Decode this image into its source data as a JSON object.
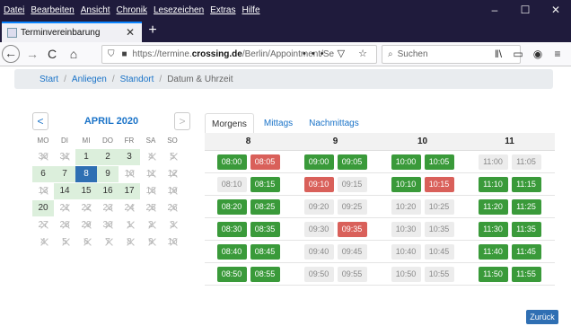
{
  "menu": [
    "Datei",
    "Bearbeiten",
    "Ansicht",
    "Chronik",
    "Lesezeichen",
    "Extras",
    "Hilfe"
  ],
  "window_controls": [
    "–",
    "☐",
    "✕"
  ],
  "tab": {
    "title": "Terminvereinbarung",
    "close": "✕",
    "new_tab": "+"
  },
  "nav": {
    "back": "←",
    "forward": "→",
    "reload": "C",
    "home": "⌂",
    "url_prefix": "https://termine.",
    "url_domain": "crossing.de",
    "url_path": "/Berlin/Appointment/Se",
    "url_icons": "••• ▽ ☆",
    "search_placeholder": "Suchen",
    "toolbar_icons": [
      "‖\\",
      "▭",
      "◉",
      "≡"
    ]
  },
  "breadcrumb": {
    "start": "Start",
    "anliegen": "Anliegen",
    "standort": "Standort",
    "current": "Datum & Uhrzeit",
    "sep": "/"
  },
  "calendar": {
    "month": "APRIL 2020",
    "prev": "<",
    "next": ">",
    "weekdays": [
      "MO",
      "DI",
      "MI",
      "DO",
      "FR",
      "SA",
      "SO"
    ],
    "cells": [
      {
        "d": "30",
        "s": "na"
      },
      {
        "d": "31",
        "s": "na"
      },
      {
        "d": "1",
        "s": "av"
      },
      {
        "d": "2",
        "s": "av"
      },
      {
        "d": "3",
        "s": "av"
      },
      {
        "d": "4",
        "s": "na"
      },
      {
        "d": "5",
        "s": "na"
      },
      {
        "d": "6",
        "s": "av"
      },
      {
        "d": "7",
        "s": "av"
      },
      {
        "d": "8",
        "s": "sel"
      },
      {
        "d": "9",
        "s": "av"
      },
      {
        "d": "10",
        "s": "na"
      },
      {
        "d": "11",
        "s": "na"
      },
      {
        "d": "12",
        "s": "na"
      },
      {
        "d": "13",
        "s": "na"
      },
      {
        "d": "14",
        "s": "av"
      },
      {
        "d": "15",
        "s": "av"
      },
      {
        "d": "16",
        "s": "av"
      },
      {
        "d": "17",
        "s": "av"
      },
      {
        "d": "18",
        "s": "na"
      },
      {
        "d": "19",
        "s": "na"
      },
      {
        "d": "20",
        "s": "av"
      },
      {
        "d": "21",
        "s": "na"
      },
      {
        "d": "22",
        "s": "na"
      },
      {
        "d": "23",
        "s": "na"
      },
      {
        "d": "24",
        "s": "na"
      },
      {
        "d": "25",
        "s": "na"
      },
      {
        "d": "26",
        "s": "na"
      },
      {
        "d": "27",
        "s": "na"
      },
      {
        "d": "28",
        "s": "na"
      },
      {
        "d": "29",
        "s": "na"
      },
      {
        "d": "30",
        "s": "na"
      },
      {
        "d": "1",
        "s": "na"
      },
      {
        "d": "2",
        "s": "na"
      },
      {
        "d": "3",
        "s": "na"
      },
      {
        "d": "4",
        "s": "na"
      },
      {
        "d": "5",
        "s": "na"
      },
      {
        "d": "6",
        "s": "na"
      },
      {
        "d": "7",
        "s": "na"
      },
      {
        "d": "8",
        "s": "na"
      },
      {
        "d": "9",
        "s": "na"
      },
      {
        "d": "10",
        "s": "na"
      }
    ]
  },
  "time_tabs": [
    "Morgens",
    "Mittags",
    "Nachmittags"
  ],
  "slot_hours": [
    "8",
    "9",
    "10",
    "11"
  ],
  "slot_rows": [
    [
      {
        "t": "08:00",
        "s": "free"
      },
      {
        "t": "08:05",
        "s": "busy"
      },
      {
        "t": "09:00",
        "s": "free"
      },
      {
        "t": "09:05",
        "s": "free"
      },
      {
        "t": "10:00",
        "s": "free"
      },
      {
        "t": "10:05",
        "s": "free"
      },
      {
        "t": "11:00",
        "s": "off"
      },
      {
        "t": "11:05",
        "s": "off"
      }
    ],
    [
      {
        "t": "08:10",
        "s": "off"
      },
      {
        "t": "08:15",
        "s": "free"
      },
      {
        "t": "09:10",
        "s": "busy"
      },
      {
        "t": "09:15",
        "s": "off"
      },
      {
        "t": "10:10",
        "s": "free"
      },
      {
        "t": "10:15",
        "s": "busy"
      },
      {
        "t": "11:10",
        "s": "free"
      },
      {
        "t": "11:15",
        "s": "free"
      }
    ],
    [
      {
        "t": "08:20",
        "s": "free"
      },
      {
        "t": "08:25",
        "s": "free"
      },
      {
        "t": "09:20",
        "s": "off"
      },
      {
        "t": "09:25",
        "s": "off"
      },
      {
        "t": "10:20",
        "s": "off"
      },
      {
        "t": "10:25",
        "s": "off"
      },
      {
        "t": "11:20",
        "s": "free"
      },
      {
        "t": "11:25",
        "s": "free"
      }
    ],
    [
      {
        "t": "08:30",
        "s": "free"
      },
      {
        "t": "08:35",
        "s": "free"
      },
      {
        "t": "09:30",
        "s": "off"
      },
      {
        "t": "09:35",
        "s": "busy"
      },
      {
        "t": "10:30",
        "s": "off"
      },
      {
        "t": "10:35",
        "s": "off"
      },
      {
        "t": "11:30",
        "s": "free"
      },
      {
        "t": "11:35",
        "s": "free"
      }
    ],
    [
      {
        "t": "08:40",
        "s": "free"
      },
      {
        "t": "08:45",
        "s": "free"
      },
      {
        "t": "09:40",
        "s": "off"
      },
      {
        "t": "09:45",
        "s": "off"
      },
      {
        "t": "10:40",
        "s": "off"
      },
      {
        "t": "10:45",
        "s": "off"
      },
      {
        "t": "11:40",
        "s": "free"
      },
      {
        "t": "11:45",
        "s": "free"
      }
    ],
    [
      {
        "t": "08:50",
        "s": "free"
      },
      {
        "t": "08:55",
        "s": "free"
      },
      {
        "t": "09:50",
        "s": "off"
      },
      {
        "t": "09:55",
        "s": "off"
      },
      {
        "t": "10:50",
        "s": "off"
      },
      {
        "t": "10:55",
        "s": "off"
      },
      {
        "t": "11:50",
        "s": "free"
      },
      {
        "t": "11:55",
        "s": "free"
      }
    ]
  ],
  "back_button": "Zurück"
}
